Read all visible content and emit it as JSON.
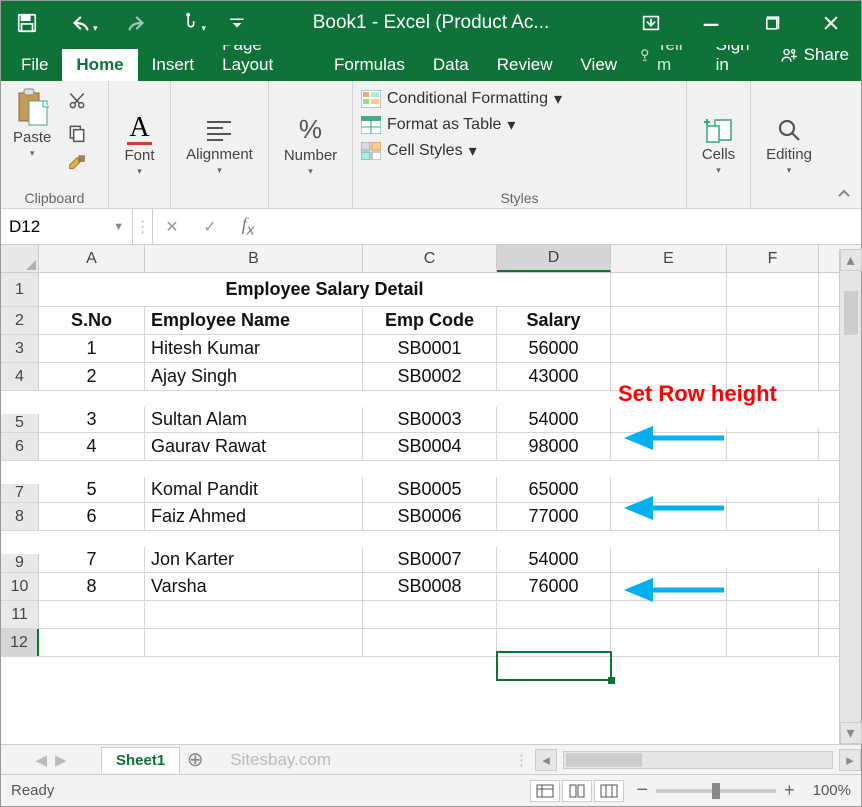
{
  "title": "Book1 - Excel (Product Ac...",
  "tabs": {
    "file": "File",
    "home": "Home",
    "insert": "Insert",
    "pagelayout": "Page Layout",
    "formulas": "Formulas",
    "data": "Data",
    "review": "Review",
    "view": "View",
    "tell": "Tell m",
    "signin": "Sign in",
    "share": "Share"
  },
  "ribbon": {
    "clipboard": "Clipboard",
    "paste": "Paste",
    "font": "Font",
    "alignment": "Alignment",
    "number": "Number",
    "styles": "Styles",
    "cond_fmt": "Conditional Formatting",
    "fmt_table": "Format as Table",
    "cell_styles": "Cell Styles",
    "cells": "Cells",
    "editing": "Editing"
  },
  "namebox": "D12",
  "columns": [
    "A",
    "B",
    "C",
    "D",
    "E",
    "F"
  ],
  "row_numbers": [
    "1",
    "2",
    "3",
    "4",
    "5",
    "6",
    "7",
    "8",
    "9",
    "10",
    "11",
    "12"
  ],
  "sheet_title": "Employee Salary Detail",
  "headers": {
    "sno": "S.No",
    "name": "Employee Name",
    "code": "Emp Code",
    "salary": "Salary"
  },
  "rows": [
    {
      "sno": "1",
      "name": "Hitesh Kumar",
      "code": "SB0001",
      "salary": "56000"
    },
    {
      "sno": "2",
      "name": "Ajay Singh",
      "code": "SB0002",
      "salary": "43000"
    },
    {
      "sno": "3",
      "name": "Sultan Alam",
      "code": "SB0003",
      "salary": "54000"
    },
    {
      "sno": "4",
      "name": "Gaurav Rawat",
      "code": "SB0004",
      "salary": "98000"
    },
    {
      "sno": "5",
      "name": "Komal Pandit",
      "code": "SB0005",
      "salary": "65000"
    },
    {
      "sno": "6",
      "name": "Faiz Ahmed",
      "code": "SB0006",
      "salary": "77000"
    },
    {
      "sno": "7",
      "name": "Jon Karter",
      "code": "SB0007",
      "salary": "54000"
    },
    {
      "sno": "8",
      "name": "Varsha",
      "code": "SB0008",
      "salary": "76000"
    }
  ],
  "annotation": "Set Row height",
  "annotation_color": "#ff0000",
  "arrow_color": "#00b0f0",
  "sheet": {
    "name": "Sheet1",
    "watermark": "Sitesbay.com"
  },
  "status": {
    "ready": "Ready",
    "zoom": "100%"
  }
}
